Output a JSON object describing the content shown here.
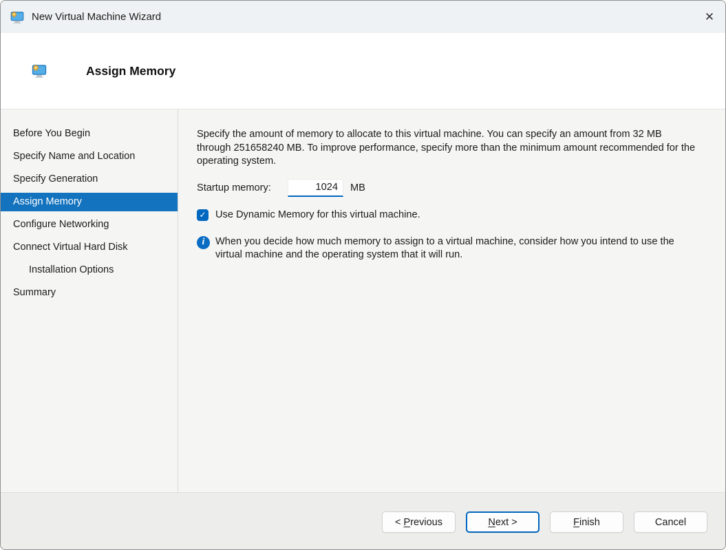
{
  "window": {
    "title": "New Virtual Machine Wizard"
  },
  "icons": {
    "close": "✕",
    "check": "✓",
    "info": "i",
    "app": "virtual-machine-monitor"
  },
  "header": {
    "title": "Assign Memory"
  },
  "sidebar": {
    "items": [
      {
        "label": "Before You Begin",
        "selected": false,
        "indented": false
      },
      {
        "label": "Specify Name and Location",
        "selected": false,
        "indented": false
      },
      {
        "label": "Specify Generation",
        "selected": false,
        "indented": false
      },
      {
        "label": "Assign Memory",
        "selected": true,
        "indented": false
      },
      {
        "label": "Configure Networking",
        "selected": false,
        "indented": false
      },
      {
        "label": "Connect Virtual Hard Disk",
        "selected": false,
        "indented": false
      },
      {
        "label": "Installation Options",
        "selected": false,
        "indented": true
      },
      {
        "label": "Summary",
        "selected": false,
        "indented": false
      }
    ]
  },
  "main": {
    "description": "Specify the amount of memory to allocate to this virtual machine. You can specify an amount from 32 MB through 251658240 MB. To improve performance, specify more than the minimum amount recommended for the operating system.",
    "startup_memory": {
      "label": "Startup memory:",
      "value": "1024",
      "unit": "MB"
    },
    "dynamic_memory": {
      "checked": true,
      "label": "Use Dynamic Memory for this virtual machine."
    },
    "info_note": "When you decide how much memory to assign to a virtual machine, consider how you intend to use the virtual machine and the operating system that it will run."
  },
  "footer": {
    "buttons": [
      {
        "name": "previous",
        "pre": "< ",
        "key": "P",
        "post": "revious",
        "default": false
      },
      {
        "name": "next",
        "pre": "",
        "key": "N",
        "post": "ext >",
        "default": true
      },
      {
        "name": "finish",
        "pre": "",
        "key": "F",
        "post": "inish",
        "default": false
      },
      {
        "name": "cancel",
        "pre": "Cancel",
        "key": "",
        "post": "",
        "default": false
      }
    ]
  },
  "colors": {
    "accent": "#0067c0",
    "sidebar_selected": "#1473be",
    "titlebar_bg": "#eff2f4",
    "header_bg": "#ffffff",
    "content_bg": "#f5f5f4",
    "footer_bg": "#ededec"
  }
}
